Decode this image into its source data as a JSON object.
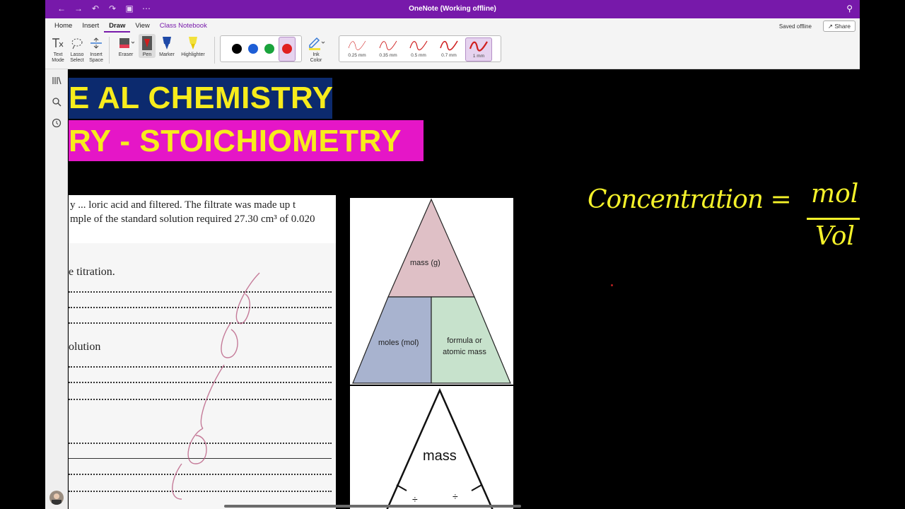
{
  "window": {
    "title": "OneNote (Working offline)"
  },
  "ribbon": {
    "tabs": [
      {
        "label": "Home"
      },
      {
        "label": "Insert"
      },
      {
        "label": "Draw"
      },
      {
        "label": "View"
      },
      {
        "label": "Class Notebook"
      }
    ],
    "active_tab": "Draw",
    "status": "Saved offline",
    "share_label": "Share",
    "tools": {
      "text_mode": "Text Mode",
      "text_mode_1": "Text",
      "text_mode_2": "Mode",
      "lasso_1": "Lasso",
      "lasso_2": "Select",
      "insert_1": "Insert",
      "insert_2": "Space",
      "eraser": "Eraser",
      "pen": "Pen",
      "marker": "Marker",
      "highlighter": "Highlighter",
      "ink_1": "Ink",
      "ink_2": "Color"
    },
    "pen_colors": [
      "#000000",
      "#1d5ed6",
      "#1aa33c",
      "#e02020"
    ],
    "selected_pen_color": "#e02020",
    "thickness": [
      {
        "label": "0.25 mm"
      },
      {
        "label": "0.35 mm"
      },
      {
        "label": "0.5 mm"
      },
      {
        "label": "0.7 mm"
      },
      {
        "label": "1 mm"
      }
    ],
    "selected_thickness": "1 mm"
  },
  "canvas": {
    "banner_top": "E AL CHEMISTRY",
    "banner_bottom": "RY - STOICHIOMETRY",
    "paper": {
      "line1": "y ... loric acid and filtered. The filtrate was made up t",
      "line2": "mple of the standard solution required 27.30 cm³ of 0.020",
      "prompt_titration": "e titration.",
      "prompt_solution": "olution"
    },
    "triangle1": {
      "top": "mass (g)",
      "left": "moles (mol)",
      "right_1": "formula or",
      "right_2": "atomic mass"
    },
    "triangle2": {
      "top": "mass",
      "divide_left": "÷",
      "divide_right": "÷"
    },
    "handwriting": {
      "equation_left": "Concentration =",
      "numerator": "mole",
      "denominator": "Vol"
    },
    "colors": {
      "banner_text": "#f7ec1c",
      "banner_top_bg": "#0c2a6e",
      "banner_bottom_bg": "#e516c7",
      "tri_top": "#dfc0c6",
      "tri_left": "#a8b3cf",
      "tri_right": "#c7e2cc",
      "ink_yellow": "#f5f22a"
    }
  }
}
